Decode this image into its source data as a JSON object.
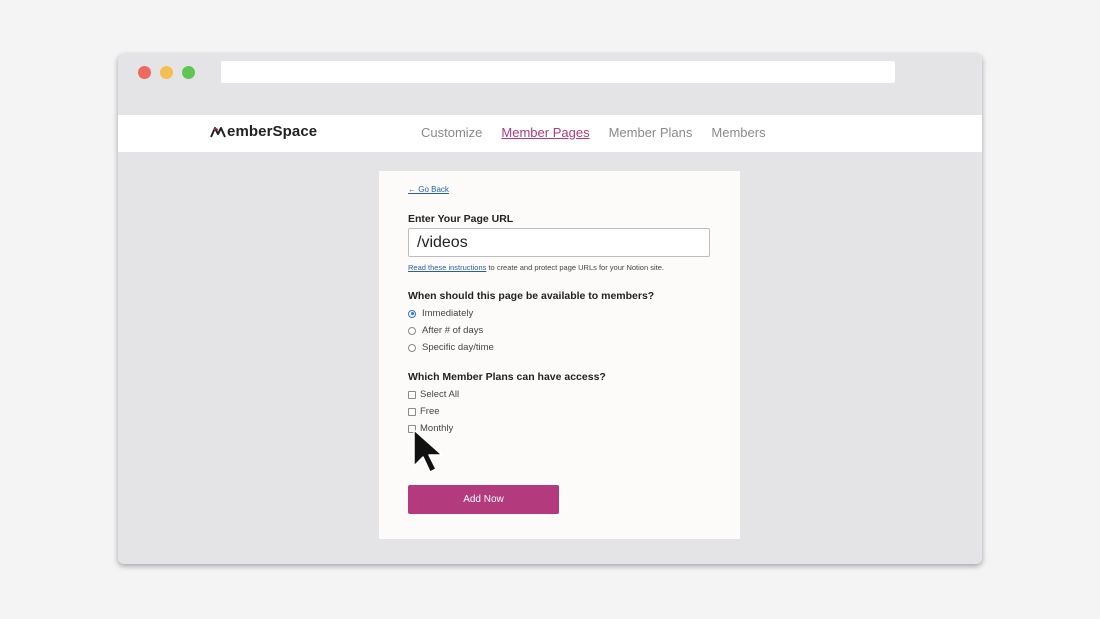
{
  "window": {
    "dots": [
      {
        "name": "close",
        "color": "#ec6a5e"
      },
      {
        "name": "minimize",
        "color": "#f4bf4f"
      },
      {
        "name": "maximize",
        "color": "#61c554"
      }
    ],
    "url": ""
  },
  "brand": {
    "logo_text": "emberSpace",
    "logo_full": "MemberSpace",
    "accent": "#b23a7d",
    "link_color": "#2a5fa8"
  },
  "nav": {
    "items": [
      {
        "label": "Customize",
        "active": false
      },
      {
        "label": "Member Pages",
        "active": true
      },
      {
        "label": "Member Plans",
        "active": false
      },
      {
        "label": "Members",
        "active": false
      }
    ]
  },
  "form": {
    "go_back": "← Go Back",
    "url_label": "Enter Your Page URL",
    "url_value": "/videos",
    "helper_link": "Read these instructions",
    "helper_text": " to create and protect page URLs for your Notion site.",
    "availability_label": "When should this page be available to members?",
    "availability_options": [
      {
        "label": "Immediately",
        "checked": true
      },
      {
        "label": "After # of days",
        "checked": false
      },
      {
        "label": "Specific day/time",
        "checked": false
      }
    ],
    "plans_label": "Which Member Plans can have access?",
    "plan_options": [
      {
        "label": "Select All",
        "checked": false
      },
      {
        "label": "Free",
        "checked": false
      },
      {
        "label": "Monthly",
        "checked": false
      }
    ],
    "submit_label": "Add Now"
  }
}
